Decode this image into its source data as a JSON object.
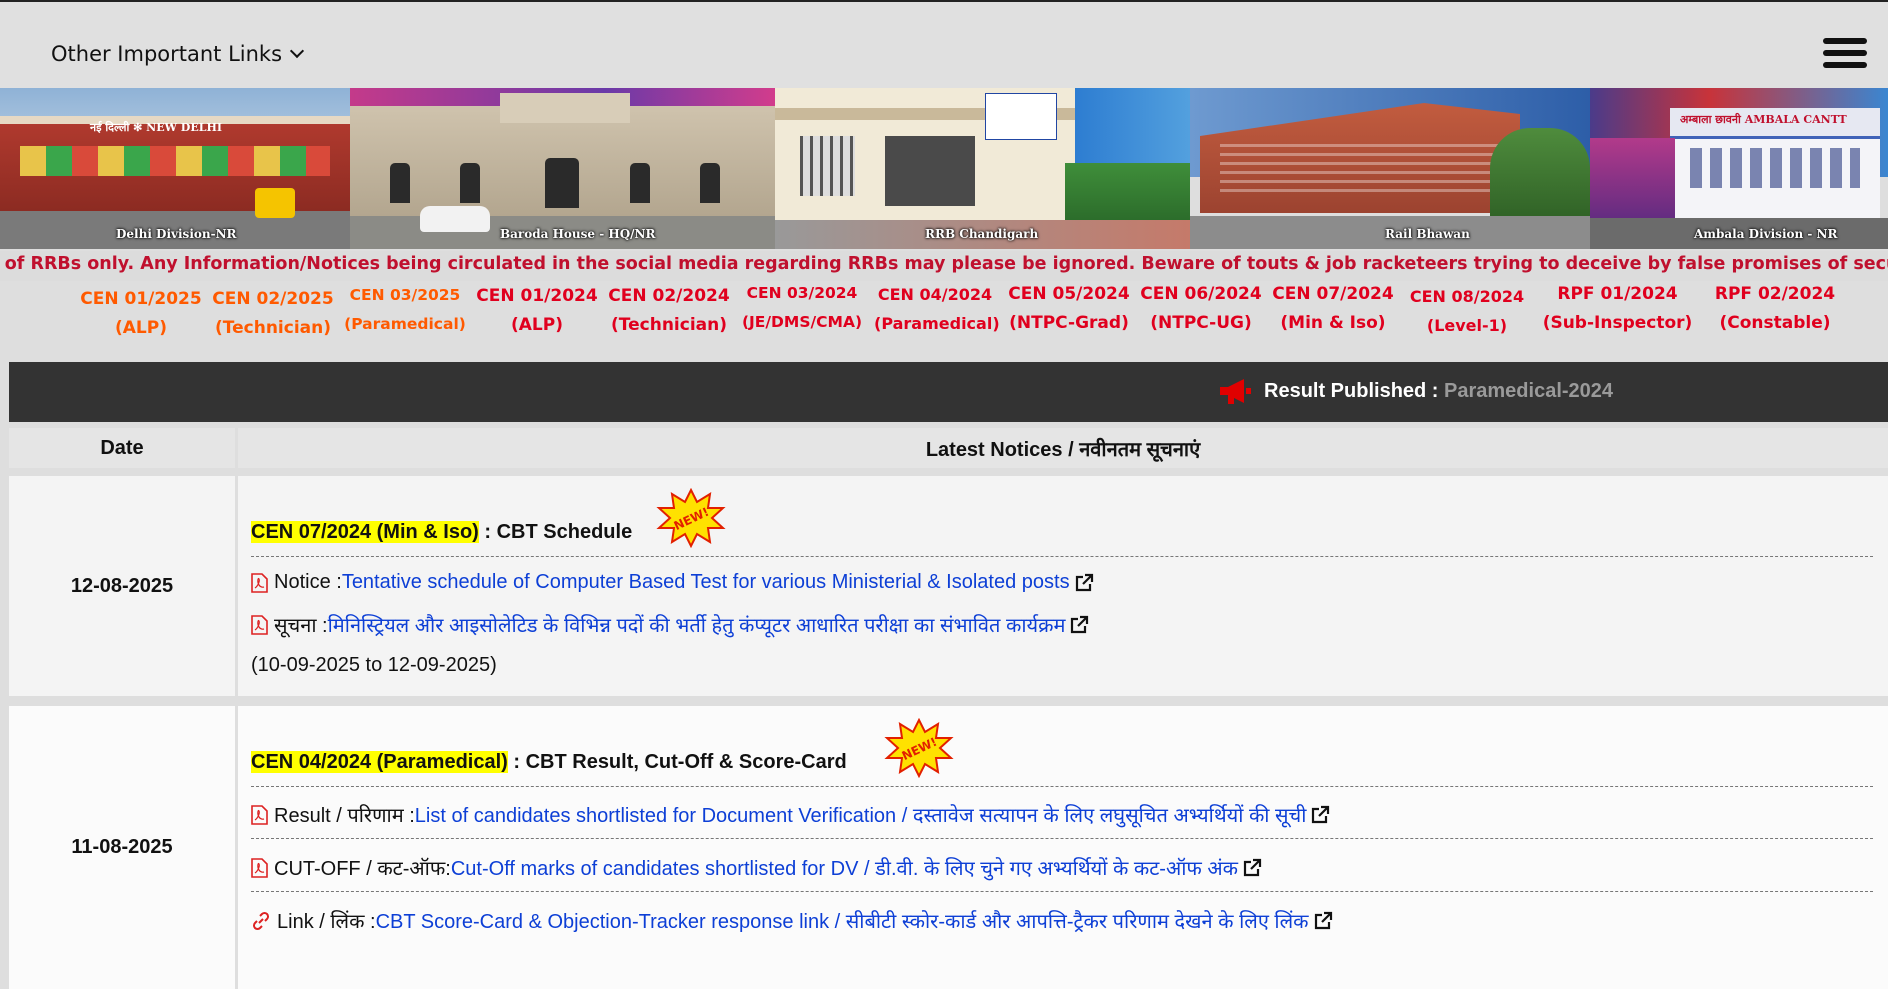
{
  "topbar": {
    "links_menu": "Other Important Links"
  },
  "banner": {
    "captions": [
      "Delhi Division-NR",
      "Baroda House - HQ/NR",
      "RRB Chandigarh",
      "Rail Bhawan",
      "Ambala Division - NR"
    ],
    "station_sign_1": "नई दिल्ली ✻ NEW DELHI",
    "station_sign_2": "अम्बाला छावनी   AMBALA CANTT"
  },
  "ticker": "ites of RRBs only. Any Information/Notices being circulated in the social media regarding RRBs may please be ignored. Beware of touts & job racketeers trying to deceive by false promises of securing job in Railways either through",
  "cen_links": [
    {
      "l1": "CEN 01/2025",
      "l2": "(ALP)"
    },
    {
      "l1": "CEN 02/2025",
      "l2": "(Technician)"
    },
    {
      "l1": "CEN 03/2025",
      "l2": "(Paramedical)"
    },
    {
      "l1": "CEN 01/2024",
      "l2": "(ALP)"
    },
    {
      "l1": "CEN 02/2024",
      "l2": "(Technician)"
    },
    {
      "l1": "CEN 03/2024",
      "l2": "(JE/DMS/CMA)"
    },
    {
      "l1": "CEN 04/2024",
      "l2": "(Paramedical)"
    },
    {
      "l1": "CEN 05/2024",
      "l2": "(NTPC-Grad)"
    },
    {
      "l1": "CEN 06/2024",
      "l2": "(NTPC-UG)"
    },
    {
      "l1": "CEN 07/2024",
      "l2": "(Min & Iso)"
    },
    {
      "l1": "CEN 08/2024",
      "l2": "(Level-1)"
    },
    {
      "l1": "RPF 01/2024",
      "l2": "(Sub-Inspector)"
    },
    {
      "l1": "RPF 02/2024",
      "l2": "(Constable)"
    }
  ],
  "colors": {
    "orange": "#ff5a00",
    "red": "#e0001e",
    "link": "#0d3fd6",
    "highlight": "#ffff00",
    "result_bar": "#333333"
  },
  "result_bar": {
    "label": "Result Published :",
    "value": "Paramedical-2024"
  },
  "table": {
    "header_date": "Date",
    "header_title": "Latest Notices / नवीनतम सूचनाएं",
    "rows": [
      {
        "date": "12-08-2025",
        "cen": "CEN 07/2024 (Min & Iso)",
        "title": " : CBT Schedule",
        "badge": "NEW!",
        "items": [
          {
            "prefix": "Notice : ",
            "link": "Tentative schedule of Computer Based Test for various Ministerial & Isolated posts"
          },
          {
            "prefix": "सूचना : ",
            "link": "मिनिस्ट्रियल और आइसोलेटिड के विभिन्न पदों की भर्ती हेतु कंप्यूटर आधारित परीक्षा का संभावित कार्यक्रम"
          }
        ],
        "note": "(10-09-2025 to 12-09-2025)"
      },
      {
        "date": "11-08-2025",
        "cen": "CEN 04/2024 (Paramedical)",
        "title": " : CBT Result, Cut-Off & Score-Card",
        "badge": "NEW!",
        "items": [
          {
            "prefix": "Result / परिणाम : ",
            "link": "List of candidates shortlisted for Document Verification / दस्तावेज सत्यापन के लिए लघुसूचित अभ्यर्थियों की सूची"
          },
          {
            "prefix": "CUT-OFF / कट-ऑफ: ",
            "link": "Cut-Off marks of candidates shortlisted for DV / डी.वी. के लिए चुने गए अभ्यर्थियों के कट-ऑफ अंक"
          },
          {
            "prefix": "Link / लिंक : ",
            "link": "CBT Score-Card & Objection-Tracker response link / सीबीटी स्कोर-कार्ड और आपत्ति-ट्रैकर परिणाम देखने के लिए लिंक"
          }
        ]
      }
    ]
  }
}
